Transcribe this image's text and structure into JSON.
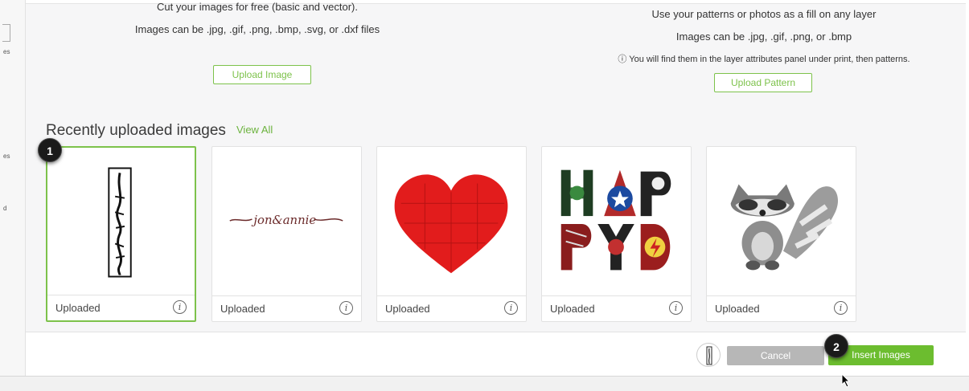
{
  "left_panel": {
    "fragments": [
      "es",
      "es",
      "d"
    ]
  },
  "upload_images": {
    "line1": "Cut your images for free (basic and vector).",
    "line2": "Images can be .jpg, .gif, .png, .bmp, .svg, or .dxf files",
    "button_label": "Upload Image"
  },
  "upload_patterns": {
    "line1": "Use your patterns or photos as a fill on any layer",
    "line2": "Images can be .jpg, .gif, .png, or .bmp",
    "note": "ⓘ You will find them in the layer attributes panel under print, then patterns.",
    "button_label": "Upload Pattern"
  },
  "recent": {
    "title": "Recently uploaded images",
    "view_all": "View All",
    "cards": [
      {
        "caption": "Uploaded",
        "thumb": "jon-annie-vertical-script",
        "selected": true
      },
      {
        "caption": "Uploaded",
        "thumb": "jon-annie-horizontal-script",
        "selected": false
      },
      {
        "caption": "Uploaded",
        "thumb": "red-puzzle-heart",
        "selected": false
      },
      {
        "caption": "Uploaded",
        "thumb": "superhero-happy-letters",
        "selected": false
      },
      {
        "caption": "Uploaded",
        "thumb": "raccoon",
        "selected": false
      }
    ],
    "info_glyph": "i"
  },
  "annotations": {
    "badge1": "1",
    "badge2": "2"
  },
  "footer": {
    "cancel_label": "Cancel",
    "insert_label": "Insert Images"
  },
  "colors": {
    "accent_green": "#6cbd2f",
    "outline_green": "#7dc24b",
    "cancel_gray": "#b7b7b7",
    "heart_red": "#e21c1c"
  }
}
